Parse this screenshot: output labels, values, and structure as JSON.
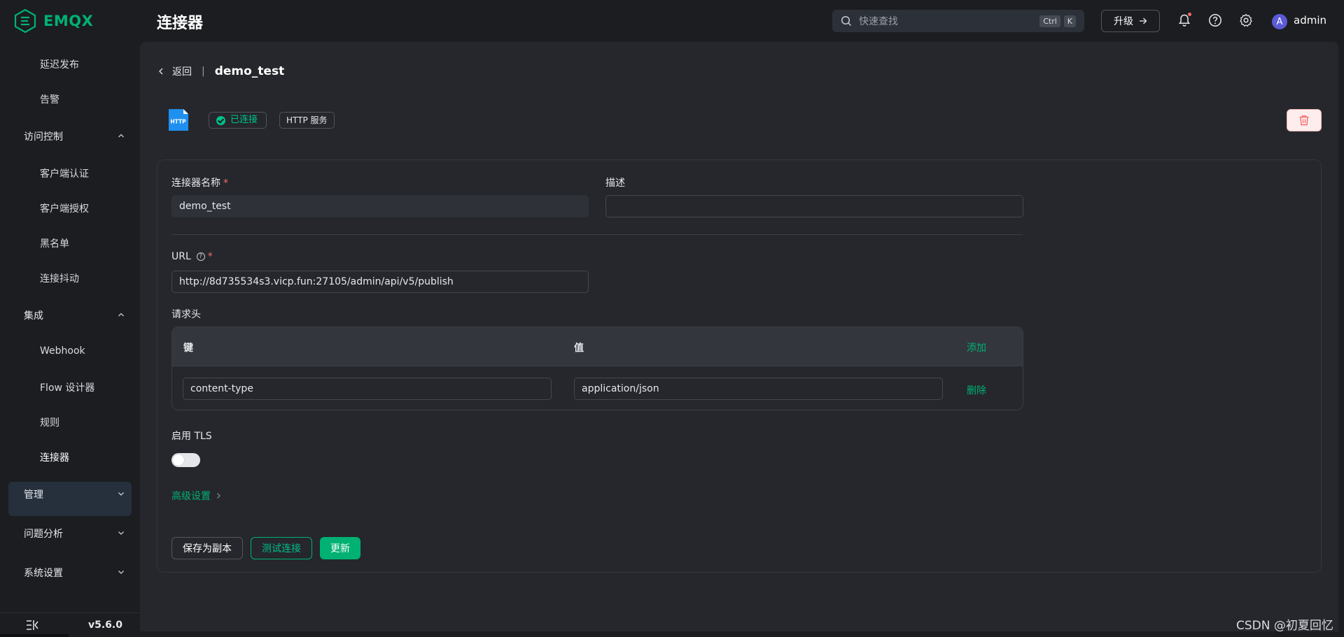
{
  "app": {
    "brand": "EMQX",
    "page_title": "连接器",
    "version": "v5.6.0"
  },
  "topbar": {
    "search_placeholder": "快速查找",
    "kbd_ctrl": "Ctrl",
    "kbd_k": "K",
    "upgrade_label": "升级",
    "username": "admin",
    "avatar_letter": "A"
  },
  "sidebar": {
    "items": [
      {
        "label": "延迟发布",
        "level": "sub"
      },
      {
        "label": "告警",
        "level": "sub"
      },
      {
        "label": "访问控制",
        "level": "group",
        "expanded": true
      },
      {
        "label": "客户端认证",
        "level": "sub"
      },
      {
        "label": "客户端授权",
        "level": "sub"
      },
      {
        "label": "黑名单",
        "level": "sub"
      },
      {
        "label": "连接抖动",
        "level": "sub"
      },
      {
        "label": "集成",
        "level": "group",
        "expanded": true
      },
      {
        "label": "Webhook",
        "level": "sub"
      },
      {
        "label": "Flow 设计器",
        "level": "sub"
      },
      {
        "label": "规则",
        "level": "sub"
      },
      {
        "label": "连接器",
        "level": "sub",
        "active": true
      },
      {
        "label": "管理",
        "level": "group",
        "expanded": false
      },
      {
        "label": "问题分析",
        "level": "group",
        "expanded": false
      },
      {
        "label": "系统设置",
        "level": "group",
        "expanded": false
      }
    ]
  },
  "header": {
    "back_label": "返回",
    "separator": "|",
    "connector_name": "demo_test",
    "icon_text": "HTTP",
    "status": "已连接",
    "type": "HTTP 服务"
  },
  "form": {
    "name_label": "连接器名称",
    "name_value": "demo_test",
    "desc_label": "描述",
    "desc_value": "",
    "url_label": "URL",
    "url_value": "http://8d735534s3.vicp.fun:27105/admin/api/v5/publish",
    "headers_label": "请求头",
    "headers_table": {
      "key_col": "键",
      "value_col": "值",
      "add_label": "添加",
      "rows": [
        {
          "key": "content-type",
          "value": "application/json",
          "action": "删除"
        }
      ]
    },
    "tls_label": "启用 TLS",
    "tls_enabled": false,
    "advanced_label": "高级设置"
  },
  "actions": {
    "save_copy": "保存为副本",
    "test_connection": "测试连接",
    "update": "更新"
  },
  "watermark": "CSDN @初夏回忆",
  "colors": {
    "accent": "#00b173",
    "danger": "#f56c6c",
    "background": "#1b1d21",
    "panel": "#25272c"
  }
}
